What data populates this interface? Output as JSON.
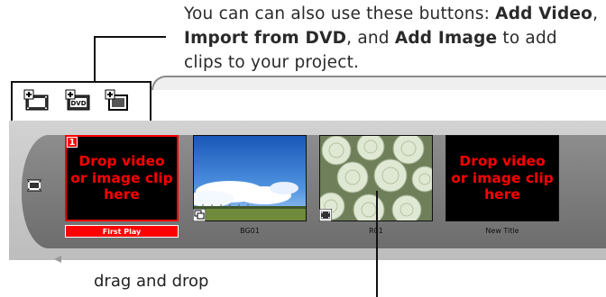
{
  "callout": {
    "part1": "You can can also use these buttons: ",
    "bold1": "Add Video",
    "sep1": ", ",
    "bold2": "Import from DVD",
    "sep2": ", and ",
    "bold3": "Add Image",
    "part2": " to add clips to your project."
  },
  "toolbar": {
    "buttons": [
      {
        "name": "add-video",
        "icon": "film-plus-icon"
      },
      {
        "name": "import-dvd",
        "icon": "dvd-plus-icon",
        "badge": "DVD"
      },
      {
        "name": "add-image",
        "icon": "image-plus-icon"
      }
    ]
  },
  "strip": {
    "slots": [
      {
        "type": "drop",
        "number": "1",
        "text_line1": "Drop video",
        "text_line2": "or image clip",
        "text_line3": "here",
        "caption": "First Play",
        "selected": true
      },
      {
        "type": "thumb",
        "image": "sky-photo",
        "caption": "BG01",
        "badge_icon": "slideshow-icon"
      },
      {
        "type": "thumb",
        "image": "roses-photo",
        "caption": "R01",
        "badge_icon": "film-icon"
      },
      {
        "type": "drop",
        "text_line1": "Drop video",
        "text_line2": "or image clip",
        "text_line3": "here",
        "caption": "New Title"
      }
    ]
  },
  "bottom_text": "drag and drop",
  "colors": {
    "accent": "#ff0000",
    "strip": "#7a7a7a"
  }
}
